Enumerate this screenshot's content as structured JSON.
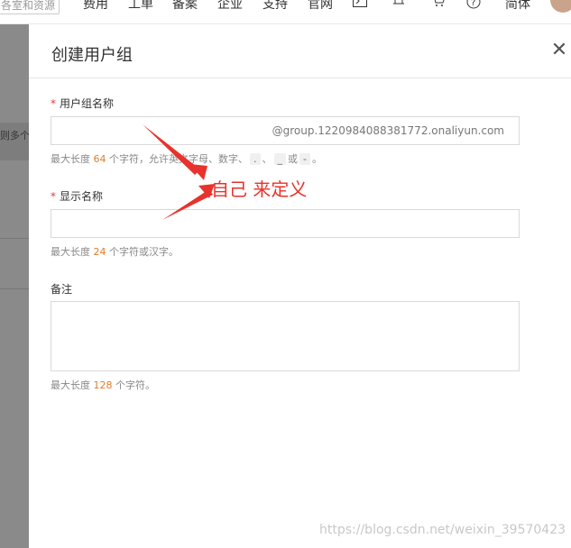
{
  "topnav": {
    "search_text": "各室和资源",
    "items": [
      "费用",
      "工单",
      "备案",
      "企业",
      "支持",
      "官网"
    ],
    "lang": "简体"
  },
  "background": {
    "row_text": "则多个用"
  },
  "dialog": {
    "title": "创建用户组",
    "close_icon": "close-icon",
    "fields": {
      "group_name": {
        "label": "用户组名称",
        "required_mark": "*",
        "value": "",
        "suffix": "@group.1220984088381772.onaliyun.com",
        "help_prefix": "最大长度",
        "help_num": "64",
        "help_rest": "个字符，允许英文字母、数字、",
        "help_chip1": ".",
        "help_sep": "、",
        "help_chip2": "_",
        "help_or": "或",
        "help_chip3": "-",
        "help_end": "。"
      },
      "display_name": {
        "label": "显示名称",
        "required_mark": "*",
        "value": "",
        "help_prefix": "最大长度",
        "help_num": "24",
        "help_rest": "个字符或汉字。"
      },
      "remark": {
        "label": "备注",
        "value": "",
        "help_prefix": "最大长度",
        "help_num": "128",
        "help_rest": "个字符。"
      }
    }
  },
  "annotation": {
    "text": "自己 来定义",
    "color": "#e8322b"
  },
  "watermark": "https://blog.csdn.net/weixin_39570423"
}
